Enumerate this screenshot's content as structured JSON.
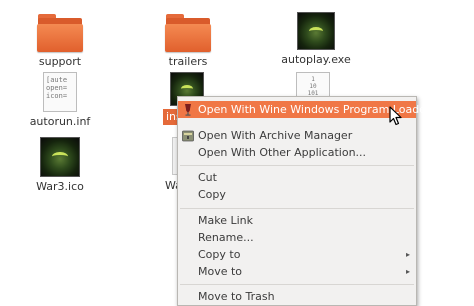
{
  "desktop": {
    "files": [
      {
        "name": "support",
        "kind": "folder"
      },
      {
        "name": "trailers",
        "kind": "folder"
      },
      {
        "name": "autoplay.exe",
        "kind": "exe"
      },
      {
        "name": "autorun.inf",
        "kind": "text",
        "preview": [
          "[aute",
          "open=",
          "icon="
        ]
      },
      {
        "name": "ins",
        "kind": "exe",
        "selected": true
      },
      {
        "name": "War3.ico",
        "kind": "ico"
      },
      {
        "name": "Wa",
        "kind": "text",
        "partial": true
      },
      {
        "name": "",
        "kind": "binary",
        "preview": [
          "1",
          "10",
          "101"
        ]
      }
    ]
  },
  "context_menu": {
    "items": [
      {
        "label": "Open With Wine Windows Program Loader",
        "icon": "wine-icon",
        "highlighted": true
      },
      {
        "label": "Open With Archive Manager",
        "icon": "archive-manager-icon"
      },
      {
        "label": "Open With Other Application..."
      },
      {
        "label": "Cut"
      },
      {
        "label": "Copy"
      },
      {
        "label": "Make Link"
      },
      {
        "label": "Rename..."
      },
      {
        "label": "Copy to",
        "submenu": true
      },
      {
        "label": "Move to",
        "submenu": true
      },
      {
        "label": "Move to Trash"
      }
    ],
    "submenu_arrow": "▸"
  },
  "colors": {
    "accent": "#f07746",
    "folder": "#e56a3a",
    "menu_bg": "#f2f1f0"
  }
}
